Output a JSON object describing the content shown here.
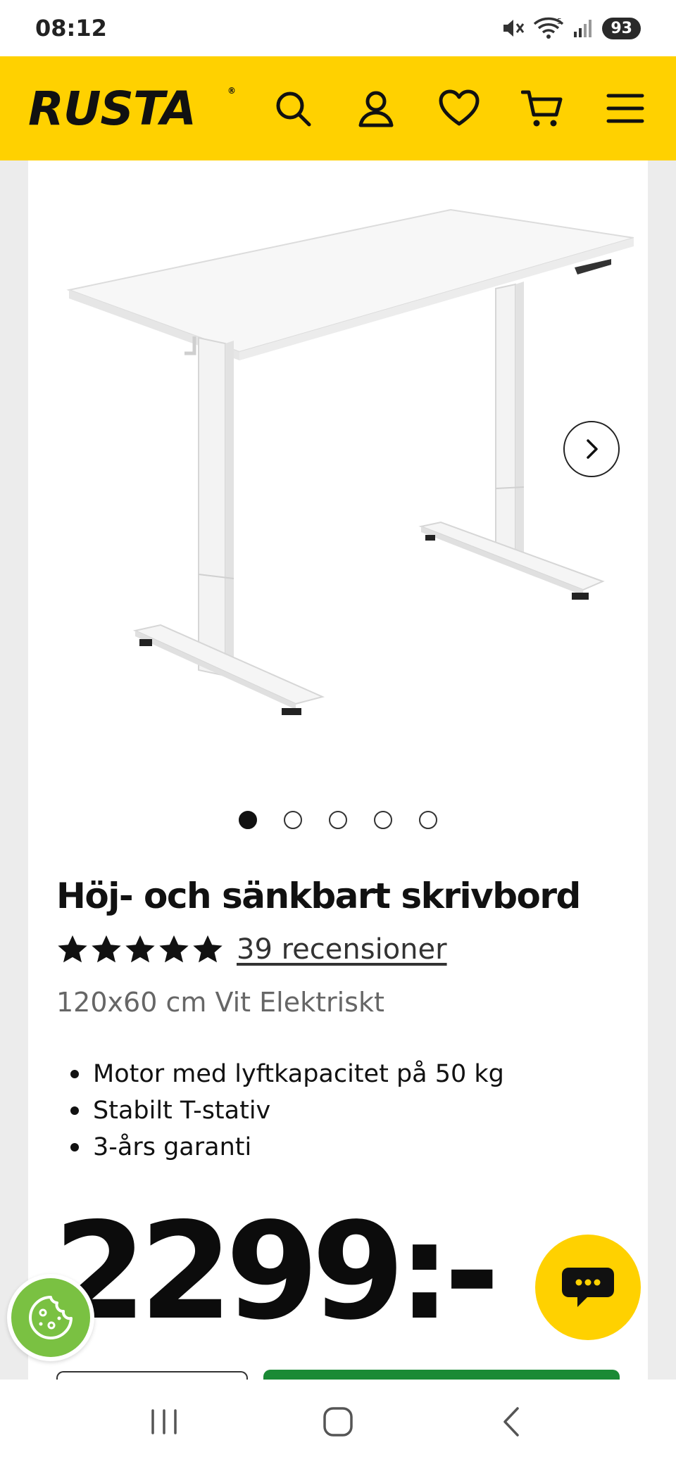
{
  "status_bar": {
    "time": "08:12",
    "battery": "93",
    "icons": [
      "mute-icon",
      "wifi-icon",
      "signal-icon",
      "battery-icon"
    ]
  },
  "header": {
    "logo": "RUSTA",
    "logo_mark": "®",
    "background": "#ffd100",
    "icons": [
      "search-icon",
      "account-icon",
      "heart-icon",
      "cart-icon",
      "menu-icon"
    ]
  },
  "product": {
    "image_icon": "standing-desk-image",
    "carousel": {
      "total": 5,
      "active": 1
    },
    "title": "Höj- och sänkbart skrivbord",
    "rating": 5,
    "reviews_link": "39 recensioner",
    "variant": "120x60 cm Vit Elektriskt",
    "features": [
      "Motor med lyftkapacitet på 50 kg",
      "Stabilt T-stativ",
      "3-års garanti"
    ],
    "price": "2299:-"
  },
  "floating": {
    "chat_icon": "chat-bubble-icon",
    "cookie_icon": "cookie-icon"
  },
  "colors": {
    "brand_yellow": "#ffd100",
    "buy_green": "#1a8a35",
    "cookie_green": "#7ac142"
  },
  "nav_bar": {
    "icons": [
      "recent-apps-icon",
      "home-icon",
      "back-icon"
    ]
  }
}
